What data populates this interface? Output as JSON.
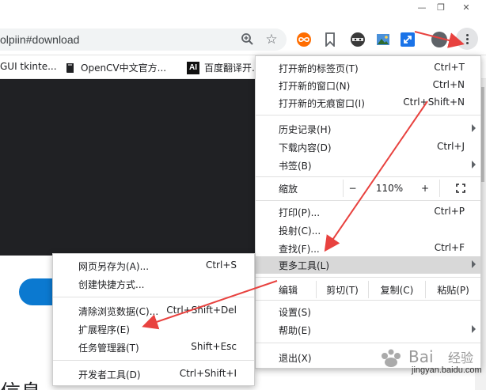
{
  "window": {
    "min_glyph": "—",
    "max_glyph": "❐",
    "close_glyph": "✕"
  },
  "address_bar": {
    "url": "olpiin#download"
  },
  "bookmarks": [
    {
      "label": "GUI tkinte..."
    },
    {
      "label": "OpenCV中文官方..."
    },
    {
      "label": "百度翻译开..."
    }
  ],
  "bookmark_ai_glyph": "AI",
  "menu": {
    "items_top": [
      {
        "label": "打开新的标签页(T)",
        "shortcut": "Ctrl+T"
      },
      {
        "label": "打开新的窗口(N)",
        "shortcut": "Ctrl+N"
      },
      {
        "label": "打开新的无痕窗口(I)",
        "shortcut": "Ctrl+Shift+N"
      }
    ],
    "history": {
      "label": "历史记录(H)"
    },
    "downloads": {
      "label": "下载内容(D)",
      "shortcut": "Ctrl+J"
    },
    "bookmarks": {
      "label": "书签(B)"
    },
    "zoom": {
      "label": "缩放",
      "minus": "−",
      "value": "110%",
      "plus": "+"
    },
    "print": {
      "label": "打印(P)...",
      "shortcut": "Ctrl+P"
    },
    "cast": {
      "label": "投射(C)..."
    },
    "find": {
      "label": "查找(F)...",
      "shortcut": "Ctrl+F"
    },
    "more_tools": {
      "label": "更多工具(L)"
    },
    "edit": {
      "label": "编辑",
      "cut": "剪切(T)",
      "copy": "复制(C)",
      "paste": "粘贴(P)"
    },
    "settings": {
      "label": "设置(S)"
    },
    "help": {
      "label": "帮助(E)"
    },
    "exit": {
      "label": "退出(X)"
    }
  },
  "submenu": {
    "items": [
      {
        "label": "网页另存为(A)...",
        "shortcut": "Ctrl+S"
      },
      {
        "label": "创建快捷方式..."
      },
      {
        "label": "清除浏览数据(C)...",
        "shortcut": "Ctrl+Shift+Del"
      },
      {
        "label": "扩展程序(E)"
      },
      {
        "label": "任务管理器(T)",
        "shortcut": "Shift+Esc"
      },
      {
        "label": "开发者工具(D)",
        "shortcut": "Ctrl+Shift+I"
      }
    ]
  },
  "page": {
    "big_text": "信息"
  },
  "watermark": {
    "site": "jingyan.baidu.com"
  },
  "colors": {
    "annotation_arrow": "#e8423f",
    "menu_highlight": "#d8d8d8",
    "page_dark": "#202124",
    "page_button": "#0b79d0"
  }
}
